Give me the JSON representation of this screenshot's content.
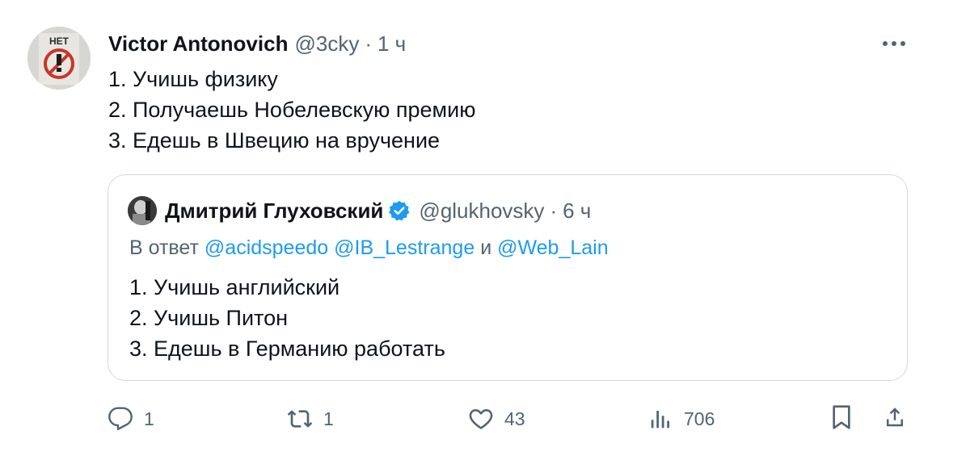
{
  "tweet": {
    "author_name": "Victor Antonovich",
    "handle": "@3cky",
    "separator": "·",
    "time": "1 ч",
    "avatar_text": "НЕТ",
    "lines": [
      "1. Учишь физику",
      "2. Получаешь Нобелевскую премию",
      "3. Едешь в Швецию на вручение"
    ]
  },
  "quote": {
    "author_name": "Дмитрий Глуховский",
    "handle": "@glukhovsky",
    "separator": "·",
    "time": "6 ч",
    "reply_prefix": "В ответ",
    "reply_mentions": [
      "@acidspeedo",
      "@IB_Lestrange",
      "@Web_Lain"
    ],
    "reply_and": "и",
    "lines": [
      "1. Учишь английский",
      "2. Учишь Питон",
      "3. Едешь в Германию работать"
    ]
  },
  "actions": {
    "reply_count": "1",
    "retweet_count": "1",
    "like_count": "43",
    "views_count": "706"
  },
  "icons": {
    "more": "more-horizontal-icon",
    "reply": "reply-icon",
    "retweet": "retweet-icon",
    "like": "heart-icon",
    "views": "views-icon",
    "bookmark": "bookmark-icon",
    "share": "share-icon",
    "verified": "verified-badge-icon"
  },
  "colors": {
    "text": "#0f1419",
    "muted": "#536471",
    "accent": "#1d9bf0",
    "border": "#cfd9de"
  }
}
